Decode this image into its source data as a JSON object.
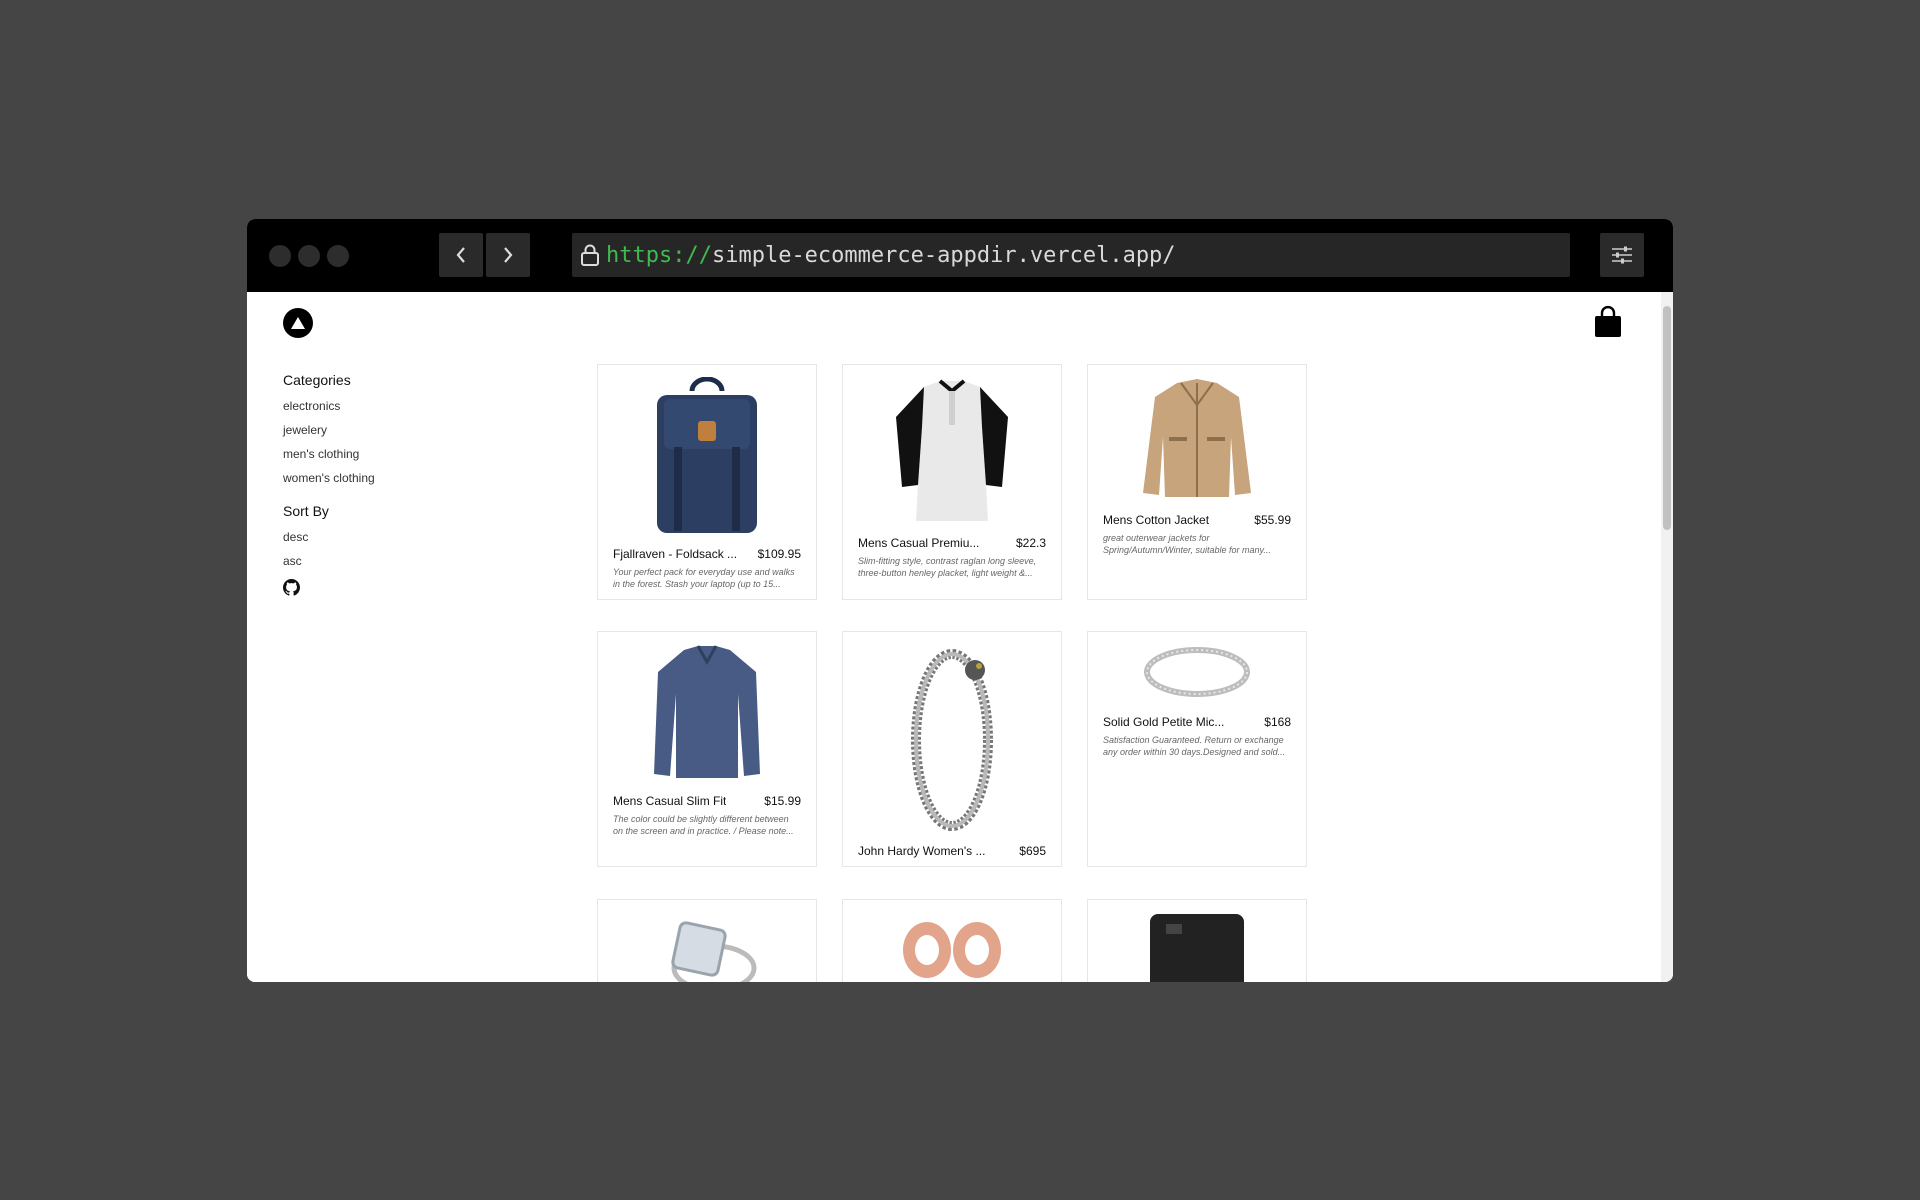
{
  "browser": {
    "url_scheme": "https://",
    "url_rest": "simple-ecommerce-appdir.vercel.app/"
  },
  "sidebar": {
    "categories_title": "Categories",
    "categories": [
      "electronics",
      "jewelery",
      "men's clothing",
      "women's clothing"
    ],
    "sort_title": "Sort By",
    "sort_options": [
      "desc",
      "asc"
    ]
  },
  "products": [
    {
      "title": "Fjallraven - Foldsack ...",
      "price": "$109.95",
      "desc": "Your perfect pack for everyday use and walks in the forest. Stash your laptop (up to 15..."
    },
    {
      "title": "Mens Casual Premiu...",
      "price": "$22.3",
      "desc": "Slim-fitting style, contrast raglan long sleeve, three-button henley placket, light weight &..."
    },
    {
      "title": "Mens Cotton Jacket",
      "price": "$55.99",
      "desc": "great outerwear jackets for Spring/Autumn/Winter, suitable for many..."
    },
    {
      "title": "Mens Casual Slim Fit",
      "price": "$15.99",
      "desc": "The color could be slightly different between on the screen and in practice. / Please note..."
    },
    {
      "title": "John Hardy Women's ...",
      "price": "$695",
      "desc": ""
    },
    {
      "title": "Solid Gold Petite Mic...",
      "price": "$168",
      "desc": "Satisfaction Guaranteed. Return or exchange any order within 30 days.Designed and sold..."
    }
  ]
}
